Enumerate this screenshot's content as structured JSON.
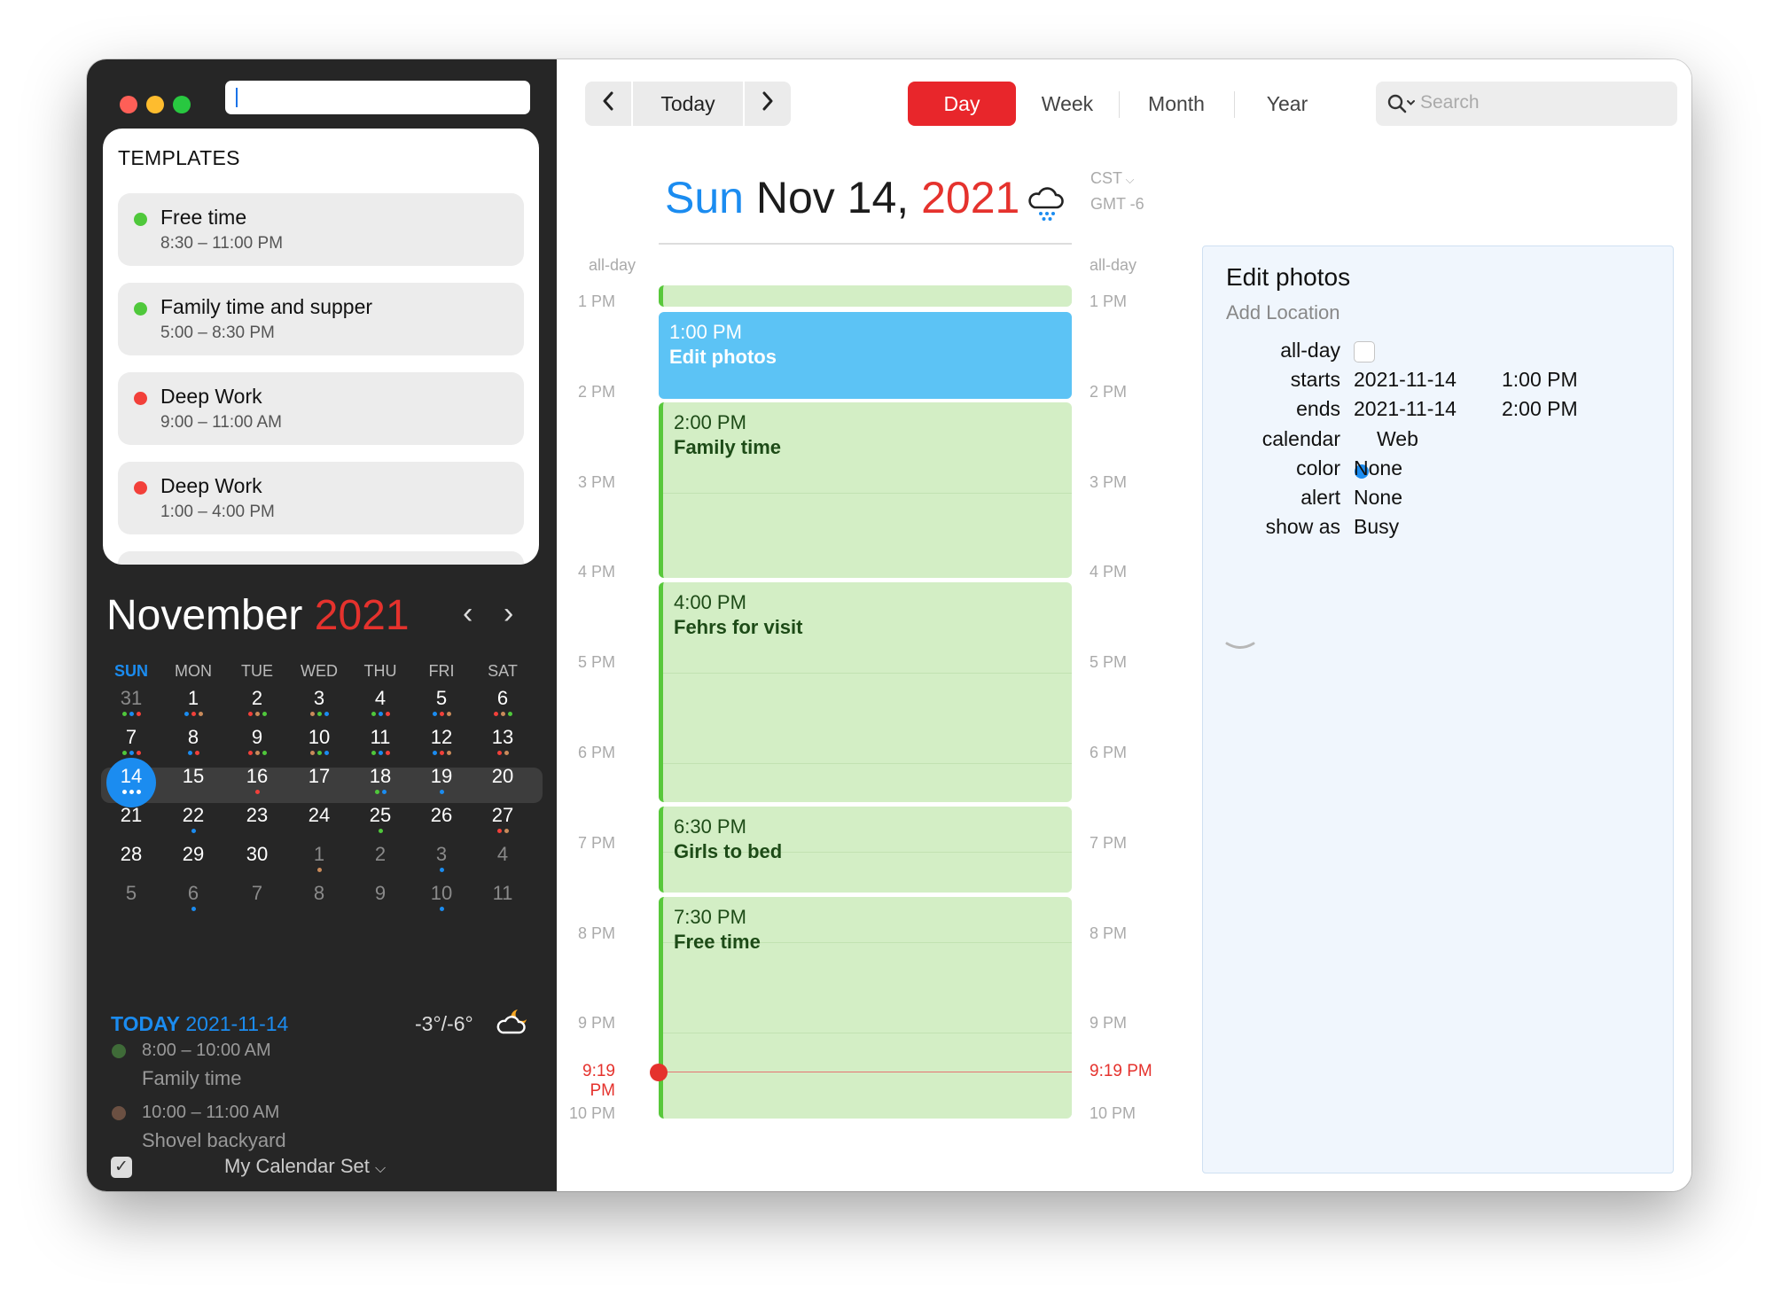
{
  "sidebar": {
    "templates_title": "TEMPLATES",
    "templates": [
      {
        "name": "Free time",
        "time": "8:30 – 11:00 PM",
        "color": "#4fc83b"
      },
      {
        "name": "Family time and supper",
        "time": "5:00 – 8:30 PM",
        "color": "#4fc83b"
      },
      {
        "name": "Deep Work",
        "time": "9:00 – 11:00 AM",
        "color": "#f2403a"
      },
      {
        "name": "Deep Work",
        "time": "1:00 – 4:00 PM",
        "color": "#f2403a"
      }
    ],
    "mini_cal": {
      "month": "November",
      "year": "2021",
      "weekdays": [
        "SUN",
        "MON",
        "TUE",
        "WED",
        "THU",
        "FRI",
        "SAT"
      ],
      "weeks": [
        [
          "31",
          "1",
          "2",
          "3",
          "4",
          "5",
          "6"
        ],
        [
          "7",
          "8",
          "9",
          "10",
          "11",
          "12",
          "13"
        ],
        [
          "14",
          "15",
          "16",
          "17",
          "18",
          "19",
          "20"
        ],
        [
          "21",
          "22",
          "23",
          "24",
          "25",
          "26",
          "27"
        ],
        [
          "28",
          "29",
          "30",
          "1",
          "2",
          "3",
          "4"
        ],
        [
          "5",
          "6",
          "7",
          "8",
          "9",
          "10",
          "11"
        ]
      ],
      "selected": "14"
    },
    "today_label": "TODAY",
    "today_date": "2021-11-14",
    "temperature": "-3°/-6°",
    "events": [
      {
        "time": "8:00 – 10:00 AM",
        "title": "Family time",
        "color": "#3f6b38"
      },
      {
        "time": "10:00 – 11:00 AM",
        "title": "Shovel backyard",
        "color": "#6b5042"
      }
    ],
    "calendar_set": "My Calendar Set"
  },
  "toolbar": {
    "today": "Today",
    "views": [
      "Day",
      "Week",
      "Month",
      "Year"
    ],
    "active_view": "Day",
    "search_placeholder": "Search"
  },
  "day_view": {
    "weekday": "Sun",
    "month_day": "Nov 14,",
    "year": "2021",
    "timezone": "CST",
    "gmt": "GMT -6",
    "allday_label": "all-day",
    "hours": [
      "1 PM",
      "2 PM",
      "3 PM",
      "4 PM",
      "5 PM",
      "6 PM",
      "7 PM",
      "8 PM",
      "9 PM",
      "10 PM"
    ],
    "now_label": "9:19 PM",
    "events": [
      {
        "time": "1:00 PM",
        "title": "Edit photos"
      },
      {
        "time": "2:00 PM",
        "title": "Family time"
      },
      {
        "time": "4:00 PM",
        "title": "Fehrs for visit"
      },
      {
        "time": "6:30 PM",
        "title": "Girls to bed"
      },
      {
        "time": "7:30 PM",
        "title": "Free time"
      }
    ]
  },
  "detail": {
    "title": "Edit photos",
    "location_placeholder": "Add Location",
    "allday_label": "all-day",
    "starts_label": "starts",
    "starts_date": "2021-11-14",
    "starts_time": "1:00 PM",
    "ends_label": "ends",
    "ends_date": "2021-11-14",
    "ends_time": "2:00 PM",
    "calendar_label": "calendar",
    "calendar_value": "Web",
    "color_label": "color",
    "color_value": "None",
    "alert_label": "alert",
    "alert_value": "None",
    "showas_label": "show as",
    "showas_value": "Busy"
  },
  "colors": {
    "accent_blue": "#1b8cf0",
    "accent_red": "#e8262b",
    "event_green": "#d3eec5",
    "event_blue": "#5cc3f5"
  }
}
